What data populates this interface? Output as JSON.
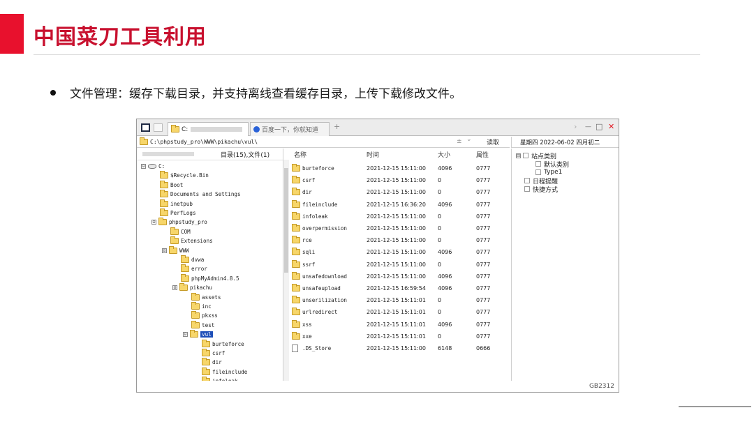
{
  "slide": {
    "title": "中国菜刀工具利用",
    "bullet": "文件管理：缓存下载目录，并支持离线查看缓存目录，上传下载修改文件。"
  },
  "window": {
    "tabs": [
      {
        "label": "C:",
        "active": true
      },
      {
        "label": "百度一下，你就知道",
        "active": false
      }
    ],
    "new_tab": "+",
    "controls": {
      "forward": "›",
      "minimize": "—",
      "maximize": "□",
      "close": "✕"
    },
    "address": "C:\\phpstudy_pro\\WWW\\pikachu\\vul\\",
    "address_extra": "±",
    "address_drop": "⌄",
    "read_button": "读取",
    "date_text": "星期四 2022-06-02 四月初二",
    "tree_header": "目录(15),文件(1)",
    "tree": [
      {
        "label": "C:",
        "expander": "⊟",
        "depth": 0,
        "drive": true
      },
      {
        "label": "$Recycle.Bin",
        "depth": 1
      },
      {
        "label": "Boot",
        "depth": 1
      },
      {
        "label": "Documents and Settings",
        "depth": 1
      },
      {
        "label": "inetpub",
        "depth": 1
      },
      {
        "label": "PerfLogs",
        "depth": 1
      },
      {
        "label": "phpstudy_pro",
        "expander": "⊟",
        "depth": 1
      },
      {
        "label": "COM",
        "depth": 2
      },
      {
        "label": "Extensions",
        "depth": 2
      },
      {
        "label": "WWW",
        "expander": "⊟",
        "depth": 2
      },
      {
        "label": "dvwa",
        "depth": 3
      },
      {
        "label": "error",
        "depth": 3
      },
      {
        "label": "phpMyAdmin4.8.5",
        "depth": 3
      },
      {
        "label": "pikachu",
        "expander": "⊟",
        "depth": 3
      },
      {
        "label": "assets",
        "depth": 4
      },
      {
        "label": "inc",
        "depth": 4
      },
      {
        "label": "pkxss",
        "depth": 4
      },
      {
        "label": "test",
        "depth": 4
      },
      {
        "label": "vul",
        "expander": "⊟",
        "depth": 4,
        "selected": true
      },
      {
        "label": "burteforce",
        "depth": 5
      },
      {
        "label": "csrf",
        "depth": 5
      },
      {
        "label": "dir",
        "depth": 5
      },
      {
        "label": "fileinclude",
        "depth": 5
      },
      {
        "label": "infoleak",
        "depth": 5
      }
    ],
    "columns": {
      "name": "名称",
      "time": "时间",
      "size": "大小",
      "attr": "属性"
    },
    "files": [
      {
        "name": "burteforce",
        "time": "2021-12-15 15:11:00",
        "size": "4096",
        "attr": "0777",
        "type": "folder"
      },
      {
        "name": "csrf",
        "time": "2021-12-15 15:11:00",
        "size": "0",
        "attr": "0777",
        "type": "folder"
      },
      {
        "name": "dir",
        "time": "2021-12-15 15:11:00",
        "size": "0",
        "attr": "0777",
        "type": "folder"
      },
      {
        "name": "fileinclude",
        "time": "2021-12-15 16:36:20",
        "size": "4096",
        "attr": "0777",
        "type": "folder"
      },
      {
        "name": "infoleak",
        "time": "2021-12-15 15:11:00",
        "size": "0",
        "attr": "0777",
        "type": "folder"
      },
      {
        "name": "overpermission",
        "time": "2021-12-15 15:11:00",
        "size": "0",
        "attr": "0777",
        "type": "folder"
      },
      {
        "name": "rce",
        "time": "2021-12-15 15:11:00",
        "size": "0",
        "attr": "0777",
        "type": "folder"
      },
      {
        "name": "sqli",
        "time": "2021-12-15 15:11:00",
        "size": "4096",
        "attr": "0777",
        "type": "folder"
      },
      {
        "name": "ssrf",
        "time": "2021-12-15 15:11:00",
        "size": "0",
        "attr": "0777",
        "type": "folder"
      },
      {
        "name": "unsafedownload",
        "time": "2021-12-15 15:11:00",
        "size": "4096",
        "attr": "0777",
        "type": "folder"
      },
      {
        "name": "unsafeupload",
        "time": "2021-12-15 16:59:54",
        "size": "4096",
        "attr": "0777",
        "type": "folder"
      },
      {
        "name": "unserilization",
        "time": "2021-12-15 15:11:01",
        "size": "0",
        "attr": "0777",
        "type": "folder"
      },
      {
        "name": "urlredirect",
        "time": "2021-12-15 15:11:01",
        "size": "0",
        "attr": "0777",
        "type": "folder"
      },
      {
        "name": "xss",
        "time": "2021-12-15 15:11:01",
        "size": "4096",
        "attr": "0777",
        "type": "folder"
      },
      {
        "name": "xxe",
        "time": "2021-12-15 15:11:01",
        "size": "0",
        "attr": "0777",
        "type": "folder"
      },
      {
        "name": ".DS_Store",
        "time": "2021-12-15 15:11:00",
        "size": "6148",
        "attr": "0666",
        "type": "file"
      }
    ],
    "side_tree": [
      {
        "label": "站点类别",
        "prefix": "⊟"
      },
      {
        "label": "默认类别",
        "prefix": ""
      },
      {
        "label": "Type1",
        "prefix": ""
      },
      {
        "label": "日程提醒",
        "prefix": ""
      },
      {
        "label": "快捷方式",
        "prefix": ""
      }
    ],
    "status": "GB2312"
  },
  "colors": {
    "accent_red": "#e8112d",
    "title_red": "#c8102e",
    "selection": "#1e4fb8"
  }
}
